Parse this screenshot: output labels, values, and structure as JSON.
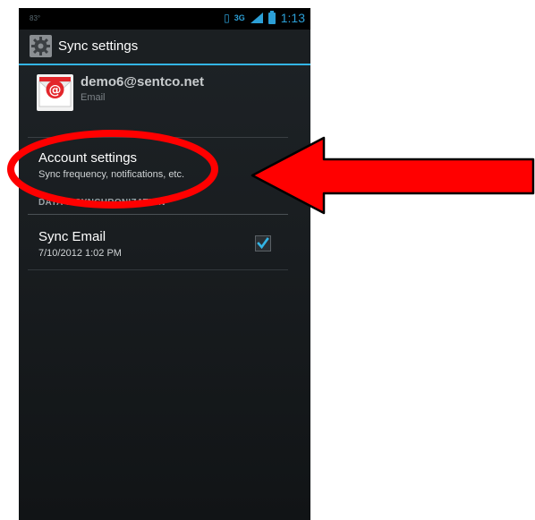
{
  "status_bar": {
    "left_glyph": "83°",
    "network": "3G",
    "time": "1:13"
  },
  "action_bar": {
    "icon": "gear-icon",
    "title": "Sync settings"
  },
  "account": {
    "icon": "email-app-icon",
    "address": "demo6@sentco.net",
    "type": "Email"
  },
  "account_settings": {
    "title": "Account settings",
    "summary": "Sync frequency, notifications, etc."
  },
  "section": {
    "header": "DATA & SYNCHRONIZATION"
  },
  "sync_email": {
    "title": "Sync Email",
    "last_sync": "7/10/2012 1:02 PM",
    "checked": true
  },
  "colors": {
    "accent": "#33b5e5",
    "annotation": "#ff0000"
  }
}
